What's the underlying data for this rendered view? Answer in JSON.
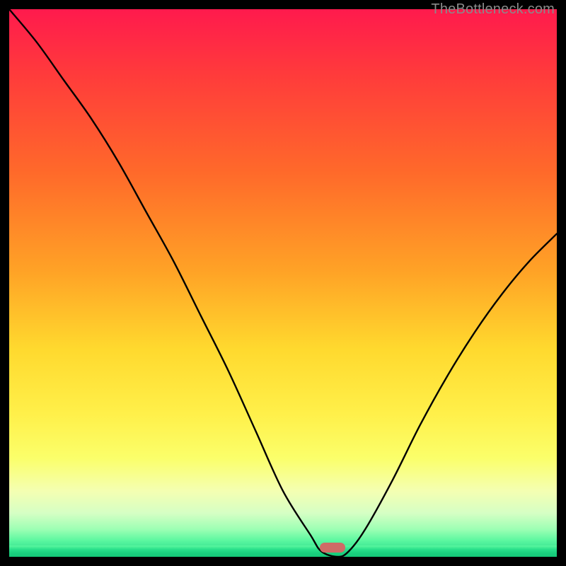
{
  "watermark": "TheBottleneck.com",
  "chart_data": {
    "type": "line",
    "title": "",
    "xlabel": "",
    "ylabel": "",
    "xlim": [
      0,
      100
    ],
    "ylim": [
      0,
      100
    ],
    "grid": false,
    "series": [
      {
        "name": "bottleneck-curve",
        "x": [
          0,
          5,
          10,
          15,
          20,
          25,
          30,
          35,
          40,
          45,
          50,
          55,
          57,
          60,
          62,
          65,
          70,
          75,
          80,
          85,
          90,
          95,
          100
        ],
        "values": [
          100,
          94,
          87,
          80,
          72,
          63,
          54,
          44,
          34,
          23,
          12,
          4,
          1,
          0,
          1,
          5,
          14,
          24,
          33,
          41,
          48,
          54,
          59
        ]
      }
    ],
    "annotations": [
      {
        "name": "optimal-marker",
        "x": 59,
        "y": 0
      }
    ],
    "background": {
      "type": "vertical-gradient",
      "stops": [
        {
          "pos": 0.0,
          "color": "#ff1a4d"
        },
        {
          "pos": 0.3,
          "color": "#ff6a2a"
        },
        {
          "pos": 0.62,
          "color": "#ffd92e"
        },
        {
          "pos": 0.88,
          "color": "#f4ffb2"
        },
        {
          "pos": 1.0,
          "color": "#18d084"
        }
      ]
    }
  }
}
